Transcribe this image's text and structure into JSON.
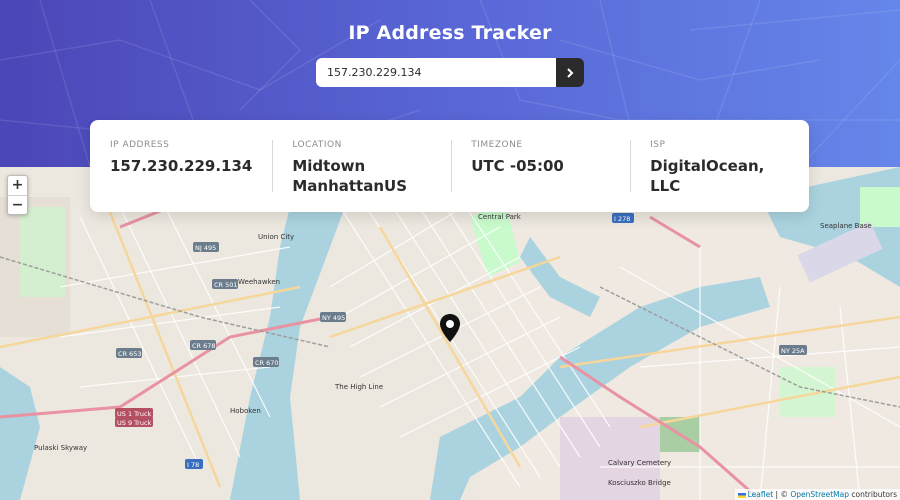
{
  "header": {
    "title": "IP Address Tracker",
    "search_value": "157.230.229.134",
    "submit_icon": "chevron-right-icon",
    "colors": {
      "gradient_start": "#4c46b8",
      "gradient_end": "#6586ea"
    }
  },
  "info": {
    "items": [
      {
        "label": "IP ADDRESS",
        "value": "157.230.229.134"
      },
      {
        "label": "LOCATION",
        "value": "Midtown ManhattanUS"
      },
      {
        "label": "TIMEZONE",
        "value": "UTC -05:00"
      },
      {
        "label": "ISP",
        "value": "DigitalOcean, LLC"
      }
    ]
  },
  "map": {
    "zoom_in": "+",
    "zoom_out": "−",
    "marker_icon": "map-pin-icon",
    "attribution": {
      "leaflet": "Leaflet",
      "separator": " | © ",
      "osm": "OpenStreetMap",
      "suffix": " contributors"
    },
    "place_labels": [
      "Union City",
      "Weehawken",
      "Hoboken",
      "Central Park",
      "Seaplane Base",
      "The High Line",
      "Calvary Cemetery",
      "Kosciuszko Bridge",
      "Pulaski Skyway"
    ],
    "road_labels": [
      "NY 495",
      "CR 501",
      "CR 678",
      "CR 670",
      "CR 653",
      "US 1 Truck",
      "US 9 Truck",
      "NY 25A",
      "NJ 495",
      "I 78",
      "I 278"
    ]
  }
}
